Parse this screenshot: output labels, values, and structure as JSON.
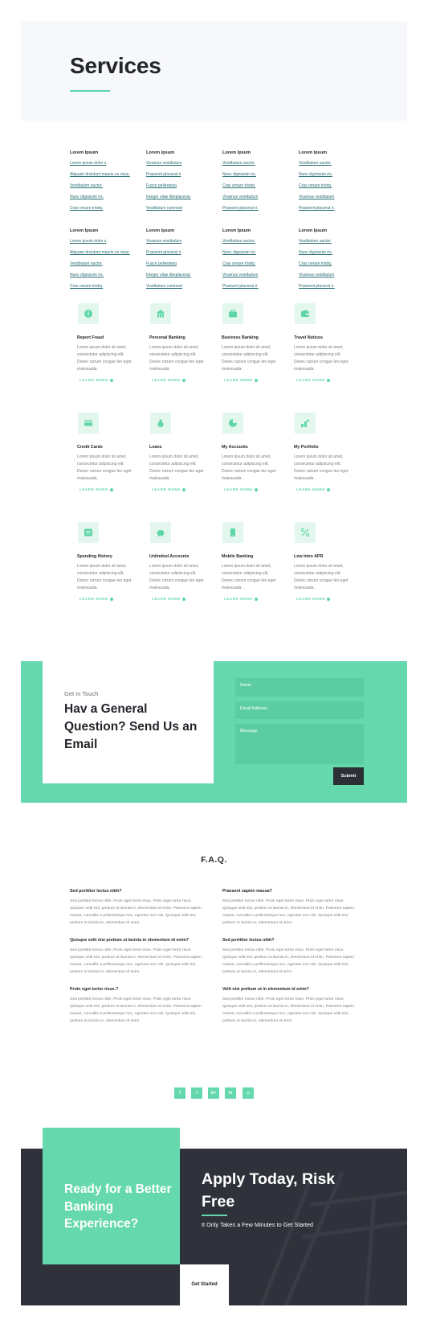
{
  "header": {
    "title": "Services"
  },
  "link_columns": [
    {
      "heading": "Lorem Ipsum",
      "links": [
        "Lorem ipsum dolor s",
        "Aliquam tincidunt mauris eu risus.",
        "Vestibulum auctor.",
        "Nunc dignissim ris.",
        "Cras ornare tristiq."
      ]
    },
    {
      "heading": "Lorem Ipsum",
      "links": [
        "Vivamus vestibulum",
        "Praesent placerat ri",
        "Fusce pellentesq",
        "Integer vitae libeplacerat.",
        "Vestibulum commod"
      ]
    },
    {
      "heading": "Lorem Ipsum",
      "links": [
        "Vestibulum auctor.",
        "Nunc dignissim ris.",
        "Cras ornare tristiq.",
        "Vivamus vestibulum",
        "Praesent placerat ri."
      ]
    },
    {
      "heading": "Lorem Ipsum",
      "links": [
        "Vestibulum auctor.",
        "Nunc dignissim ris.",
        "Cras ornare tristiq.",
        "Vivamus vestibulum",
        "Praesent placerat ri."
      ]
    },
    {
      "heading": "Lorem Ipsum",
      "links": [
        "Lorem ipsum dolor s",
        "Aliquam tincidunt mauris eu risus.",
        "Vestibulum auctor.",
        "Nunc dignissim ris.",
        "Cras ornare tristiq."
      ]
    },
    {
      "heading": "Lorem Ipsum",
      "links": [
        "Vivamus vestibulum",
        "Praesent placerat ri",
        "Fusce pellentesq",
        "Integer vitae libeplacerat.",
        "Vestibulum commod"
      ]
    },
    {
      "heading": "Lorem Ipsum",
      "links": [
        "Vestibulum auctor.",
        "Nunc dignissim ris.",
        "Cras ornare tristiq.",
        "Vivamus vestibulum",
        "Praesent placerat ri."
      ]
    },
    {
      "heading": "Lorem Ipsum",
      "links": [
        "Vestibulum auctor.",
        "Nunc dignissim ris.",
        "Cras ornare tristiq.",
        "Vivamus vestibulum",
        "Praesent placerat ri."
      ]
    }
  ],
  "services": {
    "body_lines": [
      "Lorem ipsum dolor sit amet,",
      "consectetur adipiscing elit.",
      "Donec rutrum congue leo eget",
      "malesuada."
    ],
    "more_label": "LEARN MORE",
    "items": [
      {
        "title": "Report Fraud",
        "icon": "alert-icon"
      },
      {
        "title": "Personal Banking",
        "icon": "bank-icon"
      },
      {
        "title": "Business Banking",
        "icon": "briefcase-icon"
      },
      {
        "title": "Travel Notices",
        "icon": "wallet-icon"
      },
      {
        "title": "Credit Cards",
        "icon": "credit-card-icon"
      },
      {
        "title": "Loans",
        "icon": "money-bag-icon"
      },
      {
        "title": "My Accounts",
        "icon": "pie-chart-icon"
      },
      {
        "title": "My Portfolio",
        "icon": "portfolio-icon"
      },
      {
        "title": "Spending History",
        "icon": "history-icon"
      },
      {
        "title": "Unlimited Accounts",
        "icon": "piggy-bank-icon"
      },
      {
        "title": "Mobile Banking",
        "icon": "mobile-icon"
      },
      {
        "title": "Low Intro APR",
        "icon": "percent-icon"
      }
    ]
  },
  "contact": {
    "kicker": "Get In Touch",
    "title": "Hav a General Question? Send Us an Email",
    "name_placeholder": "Name",
    "email_placeholder": "Email Address",
    "message_placeholder": "Message",
    "submit_label": "Submit"
  },
  "faq": {
    "title": "F.A.Q.",
    "items": [
      {
        "q": "Sed porttitor lectus nibh?",
        "a": "Sed porttitor lectus nibh. Proin eget tortor risus. Proin eget tortor risus. Quisque velit nisi, pretium ut lacinia in, elementum id enim. Praesent sapien massa, convallis a pellentesque nec, egestas non nisi. Quisque velit nisi, pretium ut lacinia in, elementum id enim."
      },
      {
        "q": "Praesent sapien massa?",
        "a": "Sed porttitor lectus nibh. Proin eget tortor risus. Proin eget tortor risus. Quisque velit nisi, pretium ut lacinia in, elementum id enim. Praesent sapien massa, convallis a pellentesque nec, egestas non nisi. Quisque velit nisi, pretium ut lacinia in, elementum id enim."
      },
      {
        "q": "Quisque velit nisi pretium ut lacinia in elementum id enim?",
        "a": "Sed porttitor lectus nibh. Proin eget tortor risus. Proin eget tortor risus. Quisque velit nisi, pretium ut lacinia in, elementum id enim. Praesent sapien massa, convallis a pellentesque nec, egestas non nisi. Quisque velit nisi, pretium ut lacinia in, elementum id enim."
      },
      {
        "q": "Sed porttitor lectus nibh?",
        "a": "Sed porttitor lectus nibh. Proin eget tortor risus. Proin eget tortor risus. Quisque velit nisi, pretium ut lacinia in, elementum id enim. Praesent sapien massa, convallis a pellentesque nec, egestas non nisi. Quisque velit nisi, pretium ut lacinia in, elementum id enim."
      },
      {
        "q": "Proin eget tortor risus.?",
        "a": "Sed porttitor lectus nibh. Proin eget tortor risus. Proin eget tortor risus. Quisque velit nisi, pretium ut lacinia in, elementum id enim. Praesent sapien massa, convallis a pellentesque nec, egestas non nisi. Quisque velit nisi, pretium ut lacinia in, elementum id enim."
      },
      {
        "q": "Velit nisi pretium ut in elementum id enim?",
        "a": "Sed porttitor lectus nibh. Proin eget tortor risus. Proin eget tortor risus. Quisque velit nisi, pretium ut lacinia in, elementum id enim. Praesent sapien massa, convallis a pellentesque nec, egestas non nisi. Quisque velit nisi, pretium ut lacinia in, elementum id enim."
      }
    ]
  },
  "social": [
    {
      "glyph": "f",
      "icon": "facebook-icon"
    },
    {
      "glyph": "t",
      "icon": "twitter-icon"
    },
    {
      "glyph": "G+",
      "icon": "google-plus-icon"
    },
    {
      "glyph": "in",
      "icon": "linkedin-icon"
    },
    {
      "glyph": "◎",
      "icon": "instagram-icon"
    }
  ],
  "cta": {
    "left_text": "Ready for a Better Banking Experience?",
    "title": "Apply Today, Risk Free",
    "subtitle": "It Only Takes a Few Minutes to Get Started",
    "button_label": "Get Started"
  },
  "colors": {
    "accent": "#66d8ad",
    "dark": "#2f323a",
    "link": "#2a6f73",
    "hero_bg": "#f7f8fb"
  }
}
